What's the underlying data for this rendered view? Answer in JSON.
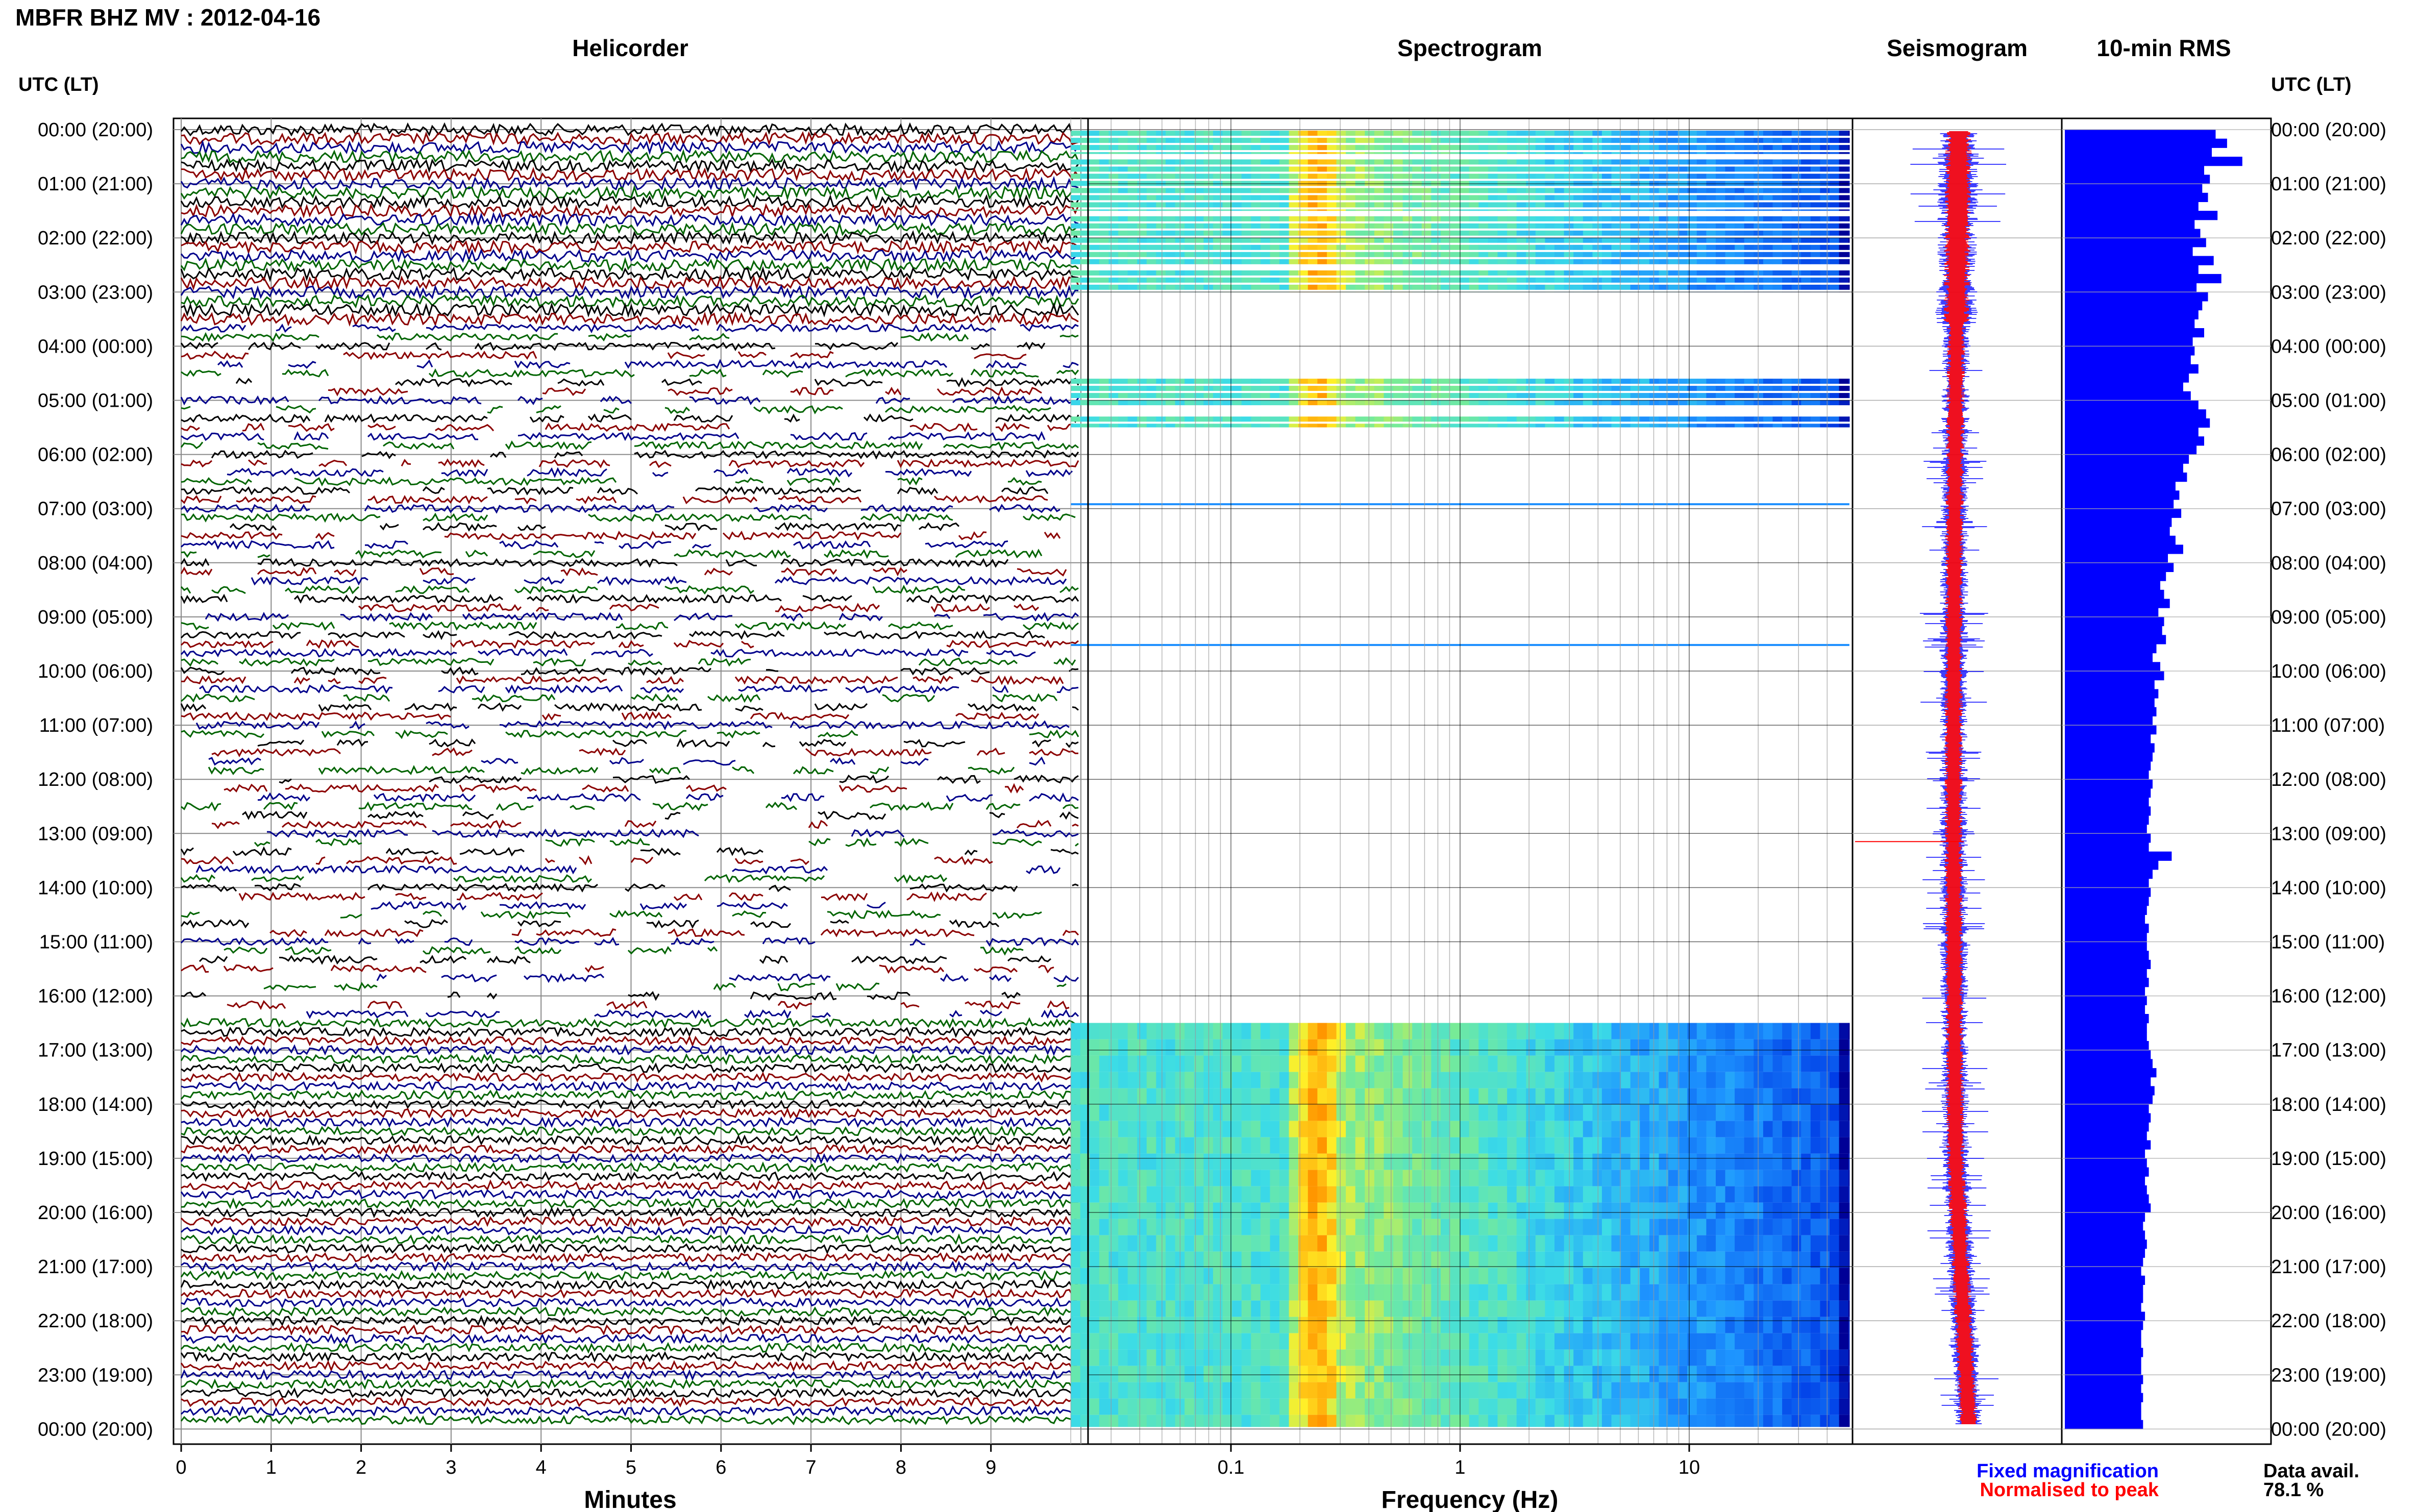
{
  "header": {
    "station_title": "MBFR BHZ MV : 2012-04-16"
  },
  "panels": {
    "helicorder": "Helicorder",
    "spectrogram": "Spectrogram",
    "seismogram": "Seismogram",
    "rms": "10-min RMS"
  },
  "axis_labels": {
    "time_left": "UTC (LT)",
    "time_right": "UTC (LT)",
    "helicorder_x": "Minutes",
    "spectrogram_x": "Frequency (Hz)"
  },
  "legend": {
    "fixed": "Fixed magnification",
    "normalised": "Normalised to peak",
    "data_avail_label": "Data avail.",
    "data_avail_value": "78.1 %"
  },
  "colors": {
    "trace_cycle": [
      "#000000",
      "#8b0000",
      "#00008b",
      "#006400"
    ],
    "fixed_magnification": "#0000ff",
    "normalised_to_peak": "#ff0000",
    "rms_bar": "#0000ff"
  },
  "chart_data": [
    {
      "type": "line",
      "title": "Helicorder",
      "xlabel": "Minutes",
      "ylabel": "UTC (LT)",
      "x_ticks": [
        0,
        1,
        2,
        3,
        4,
        5,
        6,
        7,
        8,
        9
      ],
      "xlim": [
        0,
        10
      ],
      "time_ticks": [
        "00:00 (20:00)",
        "01:00 (21:00)",
        "02:00 (22:00)",
        "03:00 (23:00)",
        "04:00 (00:00)",
        "05:00 (01:00)",
        "06:00 (02:00)",
        "07:00 (03:00)",
        "08:00 (04:00)",
        "09:00 (05:00)",
        "10:00 (06:00)",
        "11:00 (07:00)",
        "12:00 (08:00)",
        "13:00 (09:00)",
        "14:00 (10:00)",
        "15:00 (11:00)",
        "16:00 (12:00)",
        "17:00 (13:00)",
        "18:00 (14:00)",
        "19:00 (15:00)",
        "20:00 (16:00)",
        "21:00 (17:00)",
        "22:00 (18:00)",
        "23:00 (19:00)",
        "00:00 (20:00)"
      ],
      "rows_per_hour": 6
    },
    {
      "type": "heatmap",
      "title": "Spectrogram",
      "xlabel": "Frequency (Hz)",
      "x_scale": "log",
      "x_ticks": [
        "0.1",
        "1",
        "10"
      ],
      "xlim": [
        0.02,
        50
      ]
    },
    {
      "type": "line",
      "title": "Seismogram",
      "series": [
        {
          "name": "Fixed magnification"
        },
        {
          "name": "Normalised to peak"
        }
      ]
    },
    {
      "type": "bar",
      "title": "10-min RMS",
      "rms_values_relative": [
        0.79,
        0.85,
        0.77,
        0.93,
        0.73,
        0.76,
        0.72,
        0.75,
        0.7,
        0.8,
        0.68,
        0.71,
        0.74,
        0.67,
        0.78,
        0.7,
        0.82,
        0.69,
        0.75,
        0.72,
        0.7,
        0.68,
        0.73,
        0.67,
        0.68,
        0.66,
        0.7,
        0.65,
        0.62,
        0.66,
        0.7,
        0.74,
        0.76,
        0.7,
        0.73,
        0.69,
        0.65,
        0.62,
        0.64,
        0.58,
        0.6,
        0.57,
        0.61,
        0.56,
        0.55,
        0.58,
        0.62,
        0.54,
        0.57,
        0.53,
        0.5,
        0.52,
        0.55,
        0.49,
        0.52,
        0.51,
        0.53,
        0.48,
        0.46,
        0.5,
        0.52,
        0.47,
        0.49,
        0.47,
        0.48,
        0.46,
        0.48,
        0.45,
        0.47,
        0.46,
        0.45,
        0.44,
        0.46,
        0.45,
        0.44,
        0.45,
        0.44,
        0.43,
        0.45,
        0.44,
        0.56,
        0.49,
        0.46,
        0.44,
        0.45,
        0.44,
        0.43,
        0.42,
        0.44,
        0.43,
        0.43,
        0.44,
        0.45,
        0.43,
        0.44,
        0.42,
        0.43,
        0.42,
        0.44,
        0.43,
        0.43,
        0.44,
        0.45,
        0.46,
        0.48,
        0.45,
        0.47,
        0.46,
        0.44,
        0.45,
        0.44,
        0.43,
        0.45,
        0.42,
        0.43,
        0.44,
        0.42,
        0.43,
        0.44,
        0.45,
        0.42,
        0.41,
        0.42,
        0.43,
        0.42,
        0.41,
        0.4,
        0.42,
        0.41,
        0.41,
        0.4,
        0.42,
        0.41,
        0.4,
        0.4,
        0.41,
        0.4,
        0.4,
        0.41,
        0.4,
        0.41,
        0.4,
        0.4,
        0.41
      ]
    }
  ]
}
